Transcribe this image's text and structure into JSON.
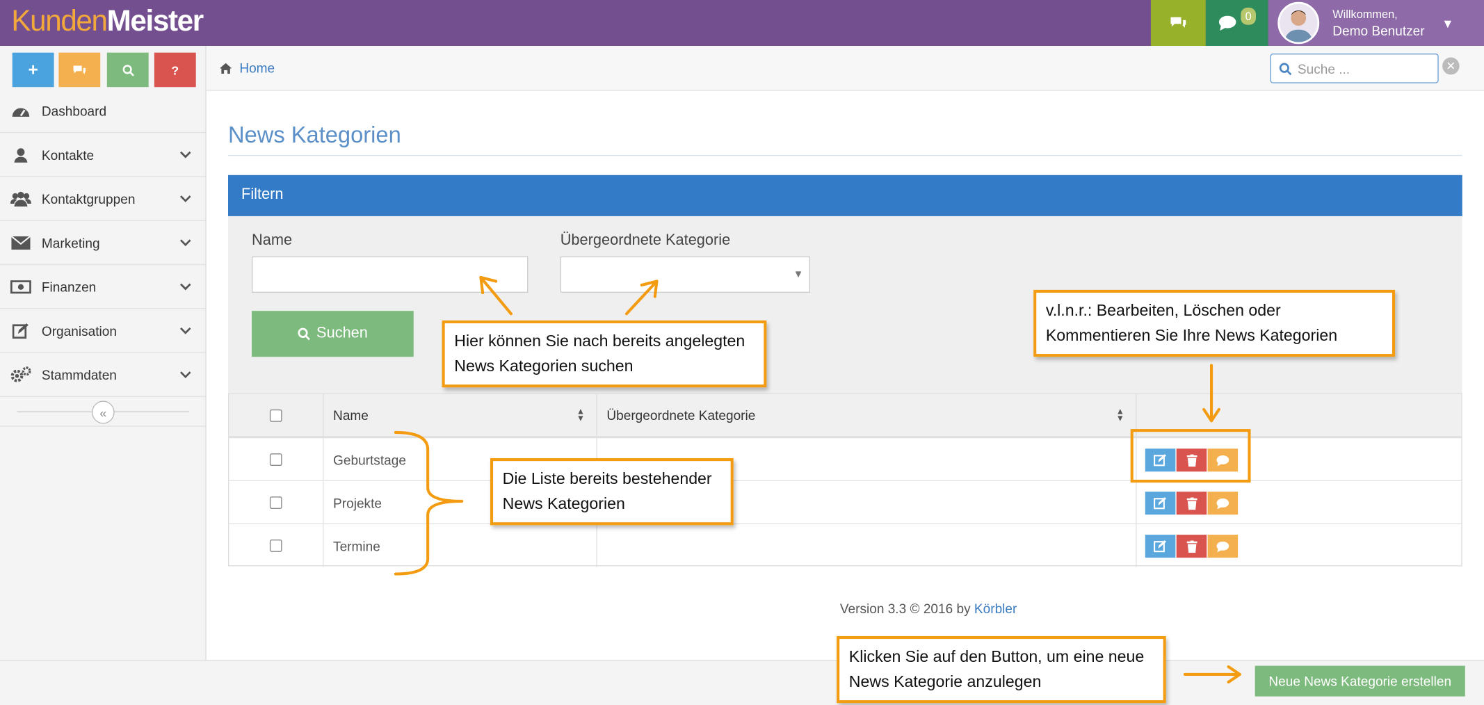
{
  "header": {
    "logo_part1": "Kunden",
    "logo_part2": "Meister",
    "chat_count": "0",
    "user_welcome": "Willkommen,",
    "user_name": "Demo Benutzer"
  },
  "quick_buttons": [
    {
      "icon": "plus-icon",
      "color": "#4aa3df"
    },
    {
      "icon": "comments-icon",
      "color": "#f4b04f"
    },
    {
      "icon": "search-icon",
      "color": "#7dba7d"
    },
    {
      "icon": "help-icon",
      "color": "#d9534f"
    }
  ],
  "sidebar": {
    "items": [
      {
        "label": "Dashboard",
        "icon": "dashboard-icon"
      },
      {
        "label": "Kontakte",
        "icon": "user-icon"
      },
      {
        "label": "Kontaktgruppen",
        "icon": "users-icon"
      },
      {
        "label": "Marketing",
        "icon": "envelope-icon"
      },
      {
        "label": "Finanzen",
        "icon": "money-icon"
      },
      {
        "label": "Organisation",
        "icon": "edit-icon"
      },
      {
        "label": "Stammdaten",
        "icon": "cogs-icon"
      }
    ]
  },
  "breadcrumb": {
    "home": "Home"
  },
  "search": {
    "placeholder": "Suche ..."
  },
  "page": {
    "title": "News Kategorien"
  },
  "filter": {
    "heading": "Filtern",
    "name_label": "Name",
    "parent_label": "Übergeordnete Kategorie",
    "search_button": "Suchen"
  },
  "table": {
    "columns": [
      "Name",
      "Übergeordnete Kategorie"
    ],
    "rows": [
      {
        "name": "Geburtstage",
        "parent": ""
      },
      {
        "name": "Projekte",
        "parent": ""
      },
      {
        "name": "Termine",
        "parent": ""
      }
    ]
  },
  "footer": {
    "version_text": "Version 3.3 © 2016 by ",
    "version_link": "Körbler",
    "new_button": "Neue News Kategorie erstellen"
  },
  "annotations": {
    "search_hint": "Hier können Sie nach bereits angelegten News Kategorien suchen",
    "actions_hint": "v.l.n.r.: Bearbeiten, Löschen oder Kommentieren Sie Ihre News Kategorien",
    "list_hint": "Die Liste bereits bestehender News Kategorien",
    "button_hint": "Klicken Sie auf den Button, um eine neue News Kategorie anzulegen"
  },
  "colors": {
    "header": "#744f8f",
    "primary": "#337bc7",
    "success": "#7dba7d",
    "annotation": "#f39c12"
  }
}
